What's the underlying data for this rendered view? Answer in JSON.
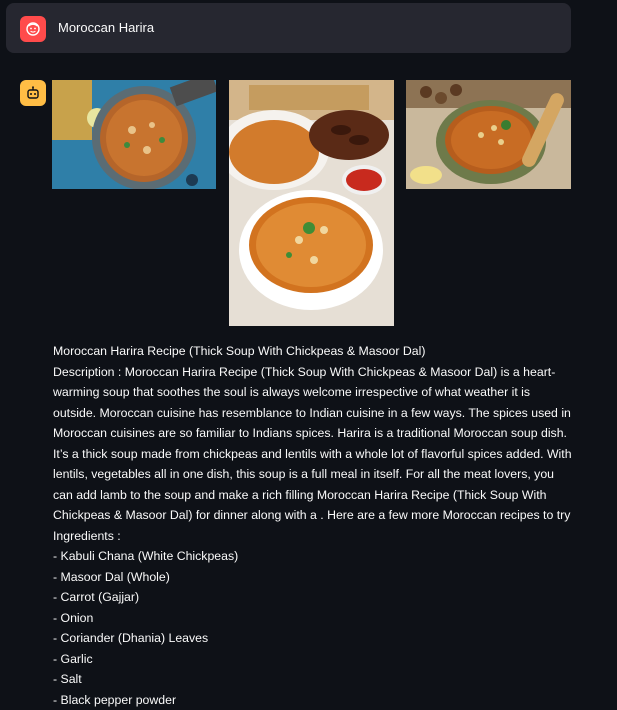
{
  "user_message": {
    "avatar_icon": "user-face-icon",
    "text": "Moroccan Harira"
  },
  "assistant": {
    "avatar_icon": "bot-icon",
    "images": [
      {
        "name": "harira-bowl-with-spoon"
      },
      {
        "name": "harira-with-dates-and-bread"
      },
      {
        "name": "harira-with-chickpeas-and-lemon"
      }
    ],
    "title": "Moroccan Harira Recipe (Thick Soup With Chickpeas & Masoor Dal)",
    "description": "Description : Moroccan Harira Recipe (Thick Soup With Chickpeas & Masoor Dal) is a heart-warming soup that soothes the soul is always welcome irrespective of what weather it is outside. Moroccan cuisine has resemblance to Indian cuisine in a few ways. The spices used in Moroccan cuisines are so familiar to Indians spices. Harira is a traditional Moroccan soup dish. It’s a thick soup made from chickpeas and lentils with a whole lot of flavorful spices added. With lentils, vegetables all in one dish, this soup is a full meal in itself. For all the meat lovers, you can add lamb to the soup and make a rich filling Moroccan Harira Recipe (Thick Soup With Chickpeas & Masoor Dal) for dinner along with a . Here are a few more Moroccan recipes to try",
    "ingredients_label": "Ingredients :",
    "ingredients": [
      "- Kabuli Chana (White Chickpeas)",
      "- Masoor Dal (Whole)",
      "- Carrot (Gajjar)",
      "- Onion",
      "- Coriander (Dhania) Leaves",
      "- Garlic",
      "- Salt",
      "- Black pepper powder"
    ]
  },
  "colors": {
    "background": "#0e1117",
    "user_bar": "#262730",
    "user_avatar": "#ff4b4b",
    "bot_avatar": "#ffbd45"
  }
}
